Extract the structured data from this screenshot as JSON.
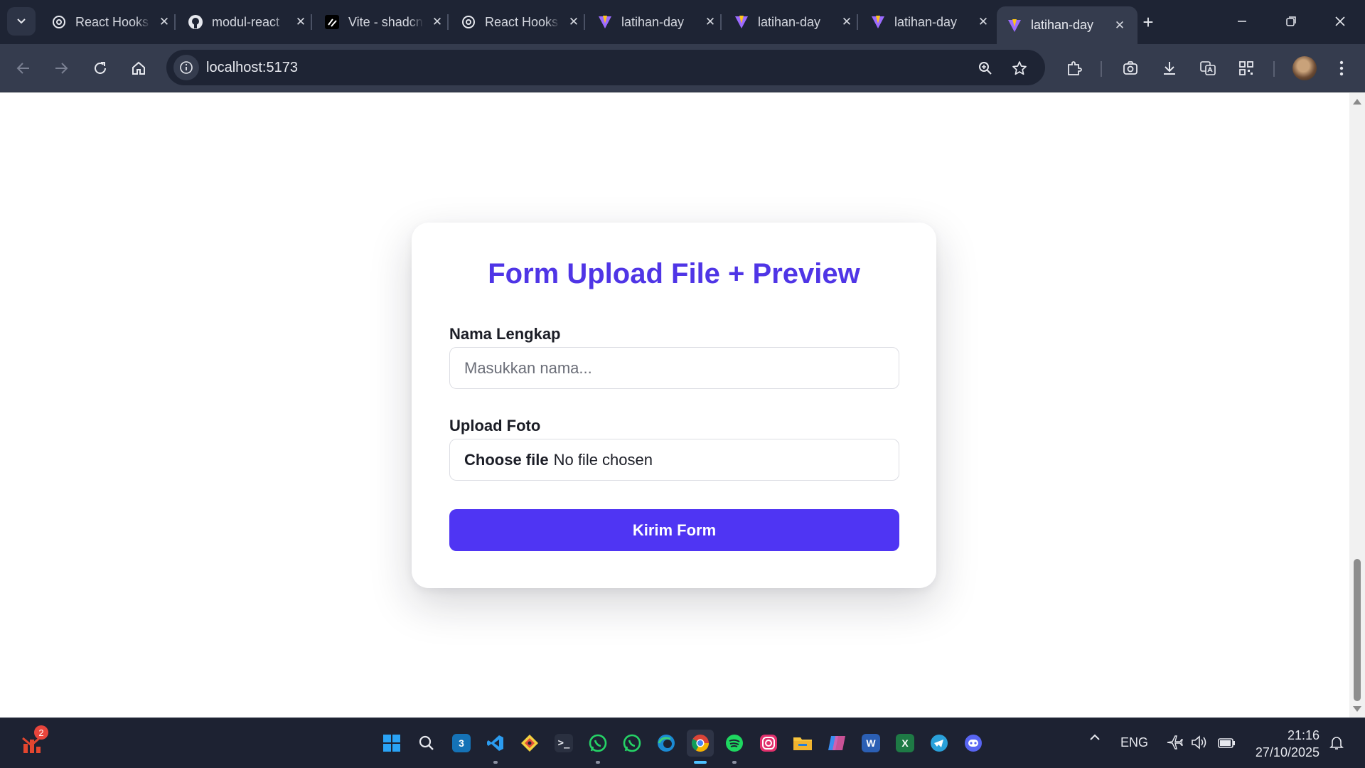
{
  "browser": {
    "tabs": [
      {
        "title": "React Hooks",
        "icon": "openai-icon",
        "active": false
      },
      {
        "title": "modul-react",
        "icon": "github-icon",
        "active": false
      },
      {
        "title": "Vite - shadcn",
        "icon": "shadcn-icon",
        "active": false
      },
      {
        "title": "React Hooks",
        "icon": "openai-icon",
        "active": false
      },
      {
        "title": "latihan-day",
        "icon": "vite-icon",
        "active": false
      },
      {
        "title": "latihan-day",
        "icon": "vite-icon",
        "active": false
      },
      {
        "title": "latihan-day",
        "icon": "vite-icon",
        "active": false
      },
      {
        "title": "latihan-day",
        "icon": "vite-icon",
        "active": true
      }
    ],
    "url": "localhost:5173"
  },
  "form": {
    "title": "Form Upload File + Preview",
    "name_label": "Nama Lengkap",
    "name_placeholder": "Masukkan nama...",
    "name_value": "",
    "upload_label": "Upload Foto",
    "file_button": "Choose file",
    "file_status": "No file chosen",
    "submit_label": "Kirim Form",
    "accent_color": "#4f35f3"
  },
  "taskbar": {
    "notification_count": "2",
    "language": "ENG",
    "time": "21:16",
    "date": "27/10/2025"
  }
}
